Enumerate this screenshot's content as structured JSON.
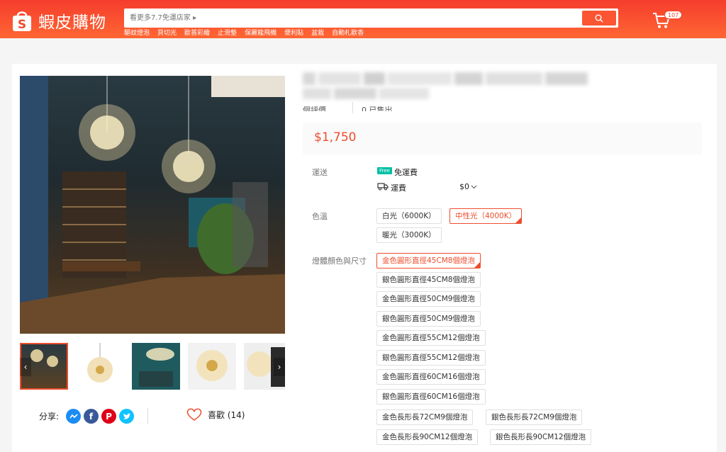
{
  "header": {
    "logo_text": "蝦皮購物",
    "search_placeholder": "看更多7.7免運店家 ▸",
    "hot_links": [
      "驅蚊燈泡",
      "貝切光",
      "歐普彩繪",
      "止滑墊",
      "保麗龍飛機",
      "便利貼",
      "盆栽",
      "自動札歐香"
    ],
    "cart_count": "107"
  },
  "product": {
    "title_line2_partial": "個評價",
    "sold_partial": "0 已售出",
    "price": "$1,750",
    "shipping": {
      "label": "運送",
      "free_badge": "Free",
      "free_text": "免運費",
      "fee_label": "運費",
      "fee_value": "$0"
    },
    "color": {
      "label": "色溫",
      "options": [
        "白光（6000K）",
        "中性光（4000K）",
        "暖光（3000K）"
      ]
    },
    "size": {
      "label": "燈體顏色與尺寸",
      "options": [
        "金色圓形直徑45CM8個燈泡",
        "銀色圓形直徑45CM8個燈泡",
        "金色圓形直徑50CM9個燈泡",
        "銀色圓形直徑50CM9個燈泡",
        "金色圓形直徑55CM12個燈泡",
        "銀色圓形直徑55CM12個燈泡",
        "金色圓形直徑60CM16個燈泡",
        "銀色圓形直徑60CM16個燈泡",
        "金色長形長72CM9個燈泡",
        "銀色長形長72CM9個燈泡",
        "金色長形長90CM12個燈泡",
        "銀色長形長90CM12個燈泡"
      ]
    }
  },
  "social": {
    "share_label": "分享:",
    "like_label": "喜歡 (14)"
  },
  "colors": {
    "brand": "#ee4d2d",
    "messenger": "#1c8cf2",
    "facebook": "#3b5999",
    "pinterest": "#de0217",
    "twitter": "#10c2ff"
  }
}
